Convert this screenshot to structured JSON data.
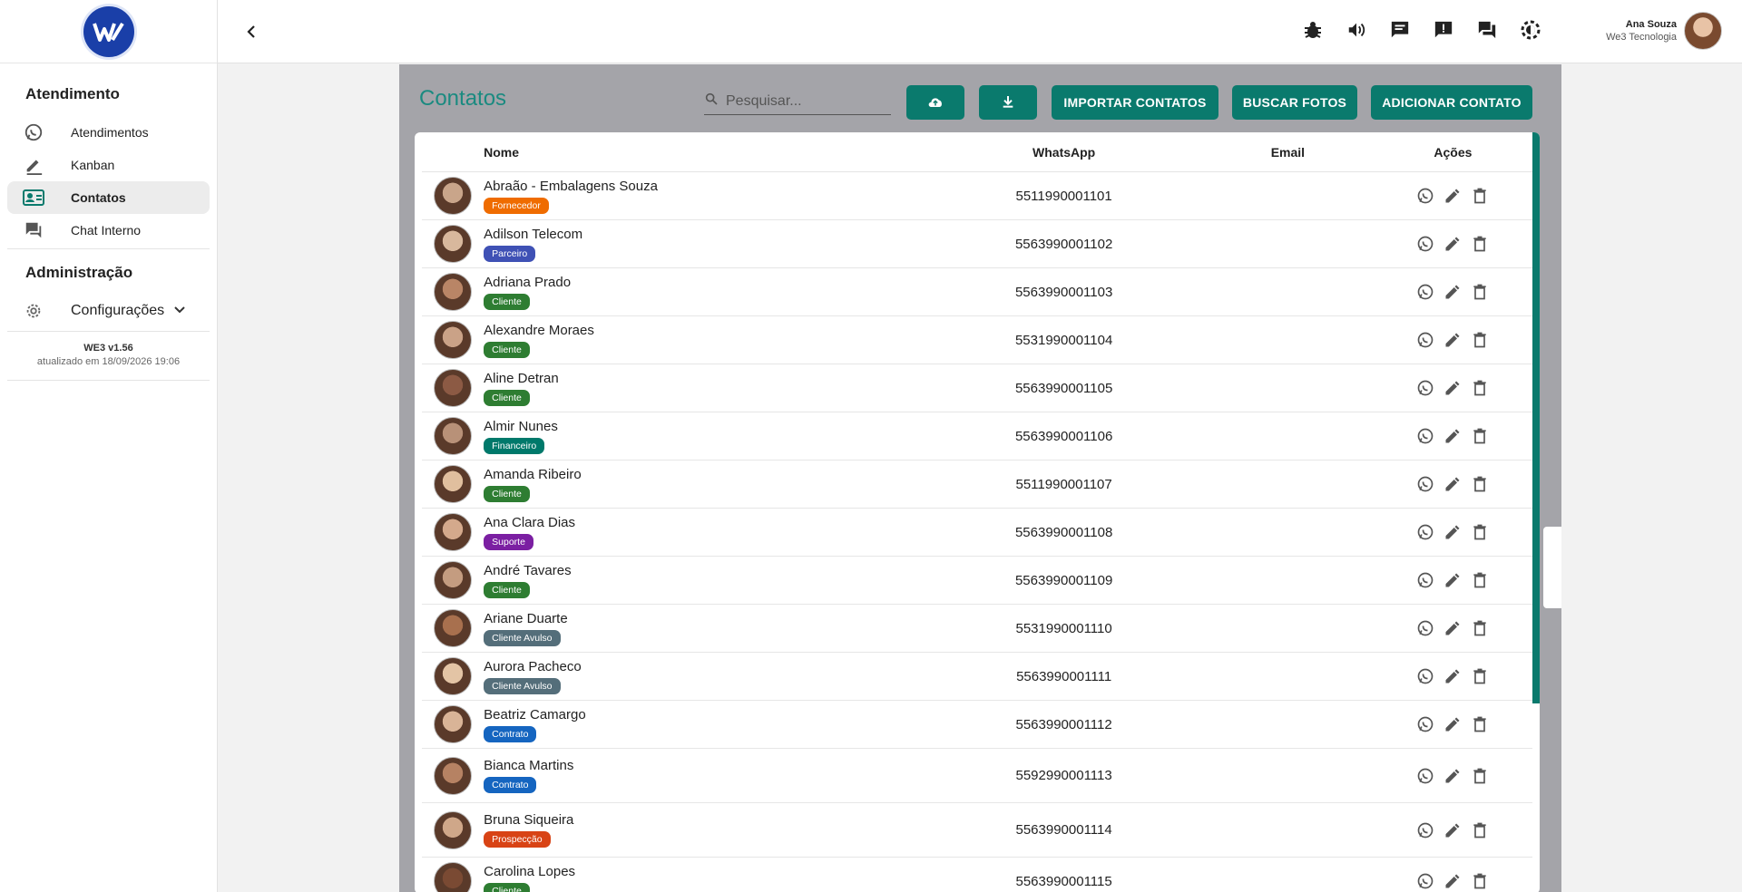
{
  "sidebar": {
    "section_atendimento": "Atendimento",
    "items": [
      {
        "label": "Atendimentos",
        "icon": "whatsapp-icon"
      },
      {
        "label": "Kanban",
        "icon": "pencil-icon"
      },
      {
        "label": "Contatos",
        "icon": "contacts-icon",
        "active": true
      },
      {
        "label": "Chat Interno",
        "icon": "chat-icon"
      }
    ],
    "section_admin": "Administração",
    "config_label": "Configurações",
    "version": "WE3 v1.56",
    "updated": "atualizado em 18/09/2026 19:06"
  },
  "topbar": {
    "user_name": "Ana Souza",
    "user_org": "We3 Tecnologia",
    "icons": [
      "bug-icon",
      "volume-icon",
      "message-icon",
      "alert-message-icon",
      "forum-icon",
      "theme-icon"
    ]
  },
  "page": {
    "title": "Contatos",
    "search_placeholder": "Pesquisar...",
    "buttons": {
      "importar": "IMPORTAR CONTATOS",
      "buscar": "BUSCAR FOTOS",
      "adicionar": "ADICIONAR CONTATO"
    }
  },
  "table": {
    "headers": {
      "nome": "Nome",
      "whatsapp": "WhatsApp",
      "email": "Email",
      "acoes": "Ações"
    },
    "rows": [
      {
        "name": "Abraão - Embalagens Souza",
        "tag": "Fornecedor",
        "tag_color": "#ef6c00",
        "phone": "5511990001101",
        "email": ""
      },
      {
        "name": "Adilson Telecom",
        "tag": "Parceiro",
        "tag_color": "#3f51b5",
        "phone": "5563990001102",
        "email": ""
      },
      {
        "name": "Adriana Prado",
        "tag": "Cliente",
        "tag_color": "#2e7d32",
        "phone": "5563990001103",
        "email": ""
      },
      {
        "name": "Alexandre Moraes",
        "tag": "Cliente",
        "tag_color": "#2e7d32",
        "phone": "5531990001104",
        "email": ""
      },
      {
        "name": "Aline Detran",
        "tag": "Cliente",
        "tag_color": "#2e7d32",
        "phone": "5563990001105",
        "email": ""
      },
      {
        "name": "Almir Nunes",
        "tag": "Financeiro",
        "tag_color": "#00796b",
        "phone": "5563990001106",
        "email": ""
      },
      {
        "name": "Amanda Ribeiro",
        "tag": "Cliente",
        "tag_color": "#2e7d32",
        "phone": "5511990001107",
        "email": ""
      },
      {
        "name": "Ana Clara Dias",
        "tag": "Suporte",
        "tag_color": "#7b1fa2",
        "phone": "5563990001108",
        "email": ""
      },
      {
        "name": "André Tavares",
        "tag": "Cliente",
        "tag_color": "#2e7d32",
        "phone": "5563990001109",
        "email": ""
      },
      {
        "name": "Ariane Duarte",
        "tag": "Cliente Avulso",
        "tag_color": "#546e7a",
        "phone": "5531990001110",
        "email": ""
      },
      {
        "name": "Aurora Pacheco",
        "tag": "Cliente Avulso",
        "tag_color": "#546e7a",
        "phone": "5563990001111",
        "email": ""
      },
      {
        "name": "Beatriz Camargo",
        "tag": "Contrato",
        "tag_color": "#1565c0",
        "phone": "5563990001112",
        "email": ""
      },
      {
        "name": "Bianca Martins",
        "tag": "Contrato",
        "tag_color": "#1565c0",
        "phone": "5592990001113",
        "email": ""
      },
      {
        "name": "Bruna Siqueira",
        "tag": "Prospecção",
        "tag_color": "#d84315",
        "phone": "5563990001114",
        "email": ""
      },
      {
        "name": "Carolina Lopes",
        "tag": "Cliente",
        "tag_color": "#2e7d32",
        "phone": "5563990001115",
        "email": ""
      }
    ]
  }
}
